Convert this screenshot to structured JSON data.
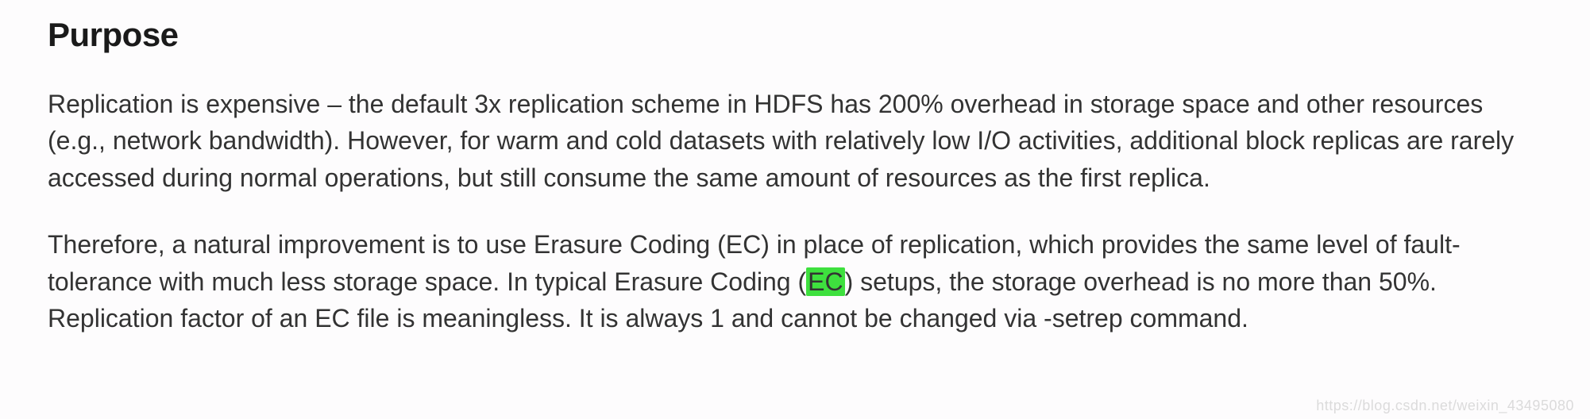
{
  "heading": "Purpose",
  "paragraph1": "Replication is expensive – the default 3x replication scheme in HDFS has 200% overhead in storage space and other resources (e.g., network bandwidth). However, for warm and cold datasets with relatively low I/O activities, additional block replicas are rarely accessed during normal operations, but still consume the same amount of resources as the first replica.",
  "paragraph2_part1": "Therefore, a natural improvement is to use Erasure Coding (EC) in place of replication, which provides the same level of fault-tolerance with much less storage space. In typical Erasure Coding (",
  "paragraph2_highlight": "EC",
  "paragraph2_part2": ") setups, the storage overhead is no more than 50%. Replication factor of an EC file is meaningless. It is always 1 and cannot be changed via -setrep command.",
  "watermark": "https://blog.csdn.net/weixin_43495080"
}
